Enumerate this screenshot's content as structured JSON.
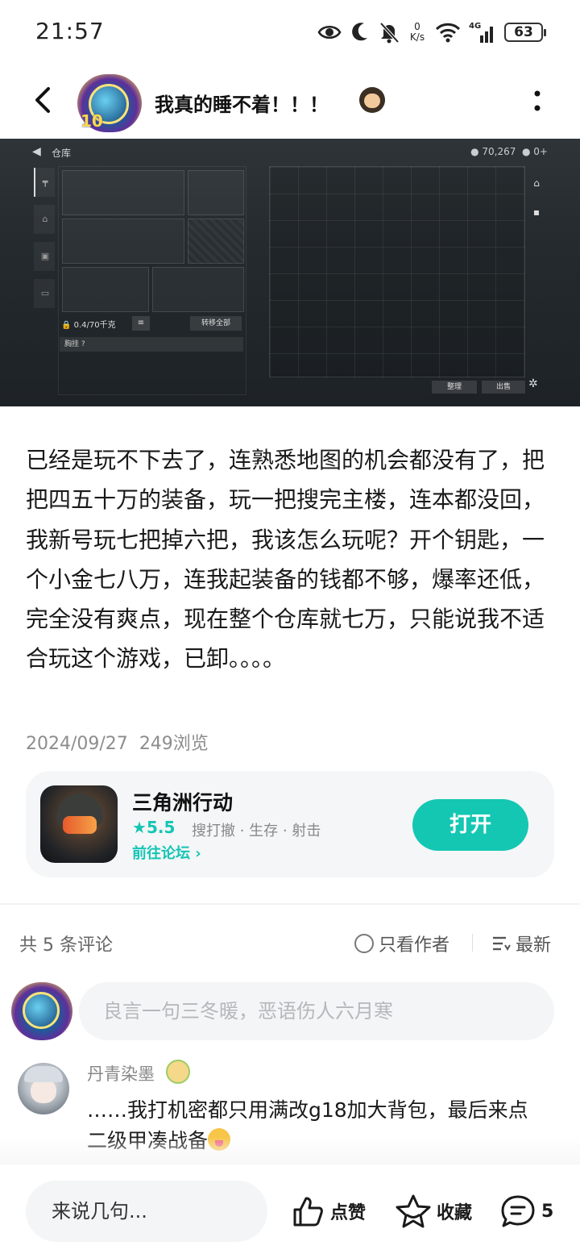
{
  "status_bar": {
    "time": "21:57",
    "net_speed_value": "0",
    "net_speed_unit": "K/s",
    "network": "4G",
    "battery": "63",
    "icons": [
      "eye-icon",
      "moon-icon",
      "mute-icon",
      "wifi-icon",
      "signal-icon",
      "battery-icon"
    ]
  },
  "header": {
    "title": "我真的睡不着！！！",
    "avatar_badge": "10",
    "icons": [
      "back-icon",
      "more-icon"
    ]
  },
  "game_screenshot": {
    "title": "仓库",
    "coins": "70,267",
    "coins2": "0+",
    "weight": "0.4/70千克",
    "transfer_all": "转移全部",
    "chest_rig": "胸挂 ?",
    "sort": "整理",
    "sell": "出售"
  },
  "post": {
    "body": "已经是玩不下去了，连熟悉地图的机会都没有了，把把四五十万的装备，玩一把搜完主楼，连本都没回，我新号玩七把掉六把，我该怎么玩呢？开个钥匙，一个小金七八万，连我起装备的钱都不够，爆率还低，完全没有爽点，现在整个仓库就七万，只能说我不适合玩这个游戏，已卸。。。。",
    "date": "2024/09/27",
    "views": "249浏览"
  },
  "app_card": {
    "name": "三角洲行动",
    "rating": "5.5",
    "tags": "搜打撤 · 生存 · 射击",
    "forum_link": "前往论坛",
    "open_label": "打开"
  },
  "comments_header": {
    "count_text": "共 5 条评论",
    "author_only": "只看作者",
    "sort": "最新"
  },
  "comment_input": {
    "placeholder": "良言一句三冬暖，恶语伤人六月寒"
  },
  "comments": [
    {
      "user": "丹青染墨",
      "text": "……我打机密都只用满改g18加大背包，最后来点二级甲凑战备"
    }
  ],
  "bottom_bar": {
    "input_placeholder": "来说几句...",
    "like_label": "点赞",
    "fav_label": "收藏",
    "comment_count": "5"
  },
  "colors": {
    "accent": "#14c7b3",
    "text": "#1a1a1a",
    "muted": "#8d8d8d"
  }
}
